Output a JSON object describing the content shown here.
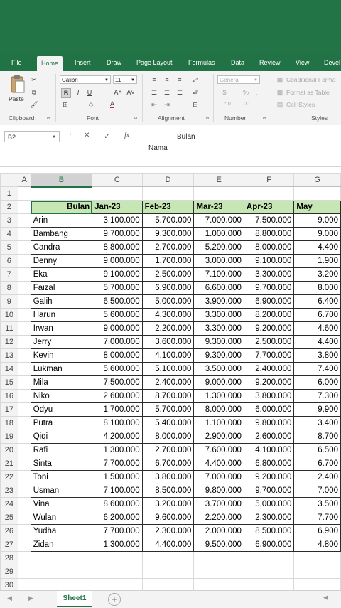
{
  "ribbon": {
    "tabs": [
      "File",
      "Home",
      "Insert",
      "Draw",
      "Page Layout",
      "Formulas",
      "Data",
      "Review",
      "View",
      "Devel"
    ],
    "active_tab": "Home",
    "clipboard": {
      "paste_label": "Paste",
      "group_label": "Clipboard"
    },
    "font": {
      "font_name": "Calibri",
      "font_size": "11",
      "bold": "B",
      "italic": "I",
      "underline": "U",
      "grow": "A˄",
      "shrink": "A˅",
      "color_a": "A",
      "group_label": "Font"
    },
    "alignment": {
      "group_label": "Alignment"
    },
    "number": {
      "format": "General",
      "currency": "$",
      "percent": "%",
      "comma": ",",
      "group_label": "Number"
    },
    "styles": {
      "conditional": "Conditional Forma",
      "format_table": "Format as Table",
      "cell_styles": "Cell Styles",
      "group_label": "Styles"
    }
  },
  "formula_bar": {
    "name_box": "B2",
    "cancel": "✕",
    "enter": "✓",
    "fx": "fx",
    "content_line1": "Bulan",
    "content_line2": "Nama"
  },
  "grid": {
    "columns": [
      "A",
      "B",
      "C",
      "D",
      "E",
      "F",
      "G"
    ],
    "selected_column": "B",
    "header_row": [
      "Bulan",
      "Jan-23",
      "Feb-23",
      "Mar-23",
      "Apr-23",
      "May"
    ],
    "rows": [
      {
        "name": "Arin",
        "values": [
          "3.100.000",
          "5.700.000",
          "7.000.000",
          "7.500.000",
          "9.000"
        ]
      },
      {
        "name": "Bambang",
        "values": [
          "9.700.000",
          "9.300.000",
          "1.000.000",
          "8.800.000",
          "9.000"
        ]
      },
      {
        "name": "Candra",
        "values": [
          "8.800.000",
          "2.700.000",
          "5.200.000",
          "8.000.000",
          "4.400"
        ]
      },
      {
        "name": "Denny",
        "values": [
          "9.000.000",
          "1.700.000",
          "3.000.000",
          "9.100.000",
          "1.900"
        ]
      },
      {
        "name": "Eka",
        "values": [
          "9.100.000",
          "2.500.000",
          "7.100.000",
          "3.300.000",
          "3.200"
        ]
      },
      {
        "name": "Faizal",
        "values": [
          "5.700.000",
          "6.900.000",
          "6.600.000",
          "9.700.000",
          "8.000"
        ]
      },
      {
        "name": "Galih",
        "values": [
          "6.500.000",
          "5.000.000",
          "3.900.000",
          "6.900.000",
          "6.400"
        ]
      },
      {
        "name": "Harun",
        "values": [
          "5.600.000",
          "4.300.000",
          "3.300.000",
          "8.200.000",
          "6.700"
        ]
      },
      {
        "name": "Irwan",
        "values": [
          "9.000.000",
          "2.200.000",
          "3.300.000",
          "9.200.000",
          "4.600"
        ]
      },
      {
        "name": "Jerry",
        "values": [
          "7.000.000",
          "3.600.000",
          "9.300.000",
          "2.500.000",
          "4.400"
        ]
      },
      {
        "name": "Kevin",
        "values": [
          "8.000.000",
          "4.100.000",
          "9.300.000",
          "7.700.000",
          "3.800"
        ]
      },
      {
        "name": "Lukman",
        "values": [
          "5.600.000",
          "5.100.000",
          "3.500.000",
          "2.400.000",
          "7.400"
        ]
      },
      {
        "name": "Mila",
        "values": [
          "7.500.000",
          "2.400.000",
          "9.000.000",
          "9.200.000",
          "6.000"
        ]
      },
      {
        "name": "Niko",
        "values": [
          "2.600.000",
          "8.700.000",
          "1.300.000",
          "3.800.000",
          "7.300"
        ]
      },
      {
        "name": "Odyu",
        "values": [
          "1.700.000",
          "5.700.000",
          "8.000.000",
          "6.000.000",
          "9.900"
        ]
      },
      {
        "name": "Putra",
        "values": [
          "8.100.000",
          "5.400.000",
          "1.100.000",
          "9.800.000",
          "3.400"
        ]
      },
      {
        "name": "Qiqi",
        "values": [
          "4.200.000",
          "8.000.000",
          "2.900.000",
          "2.600.000",
          "8.700"
        ]
      },
      {
        "name": "Rafi",
        "values": [
          "1.300.000",
          "2.700.000",
          "7.600.000",
          "4.100.000",
          "6.500"
        ]
      },
      {
        "name": "Sinta",
        "values": [
          "7.700.000",
          "6.700.000",
          "4.400.000",
          "6.800.000",
          "6.700"
        ]
      },
      {
        "name": "Toni",
        "values": [
          "1.500.000",
          "3.800.000",
          "7.000.000",
          "9.200.000",
          "2.400"
        ]
      },
      {
        "name": "Usman",
        "values": [
          "7.100.000",
          "8.500.000",
          "9.800.000",
          "9.700.000",
          "7.000"
        ]
      },
      {
        "name": "Vina",
        "values": [
          "8.600.000",
          "3.200.000",
          "3.700.000",
          "5.000.000",
          "3.500"
        ]
      },
      {
        "name": "Wulan",
        "values": [
          "6.200.000",
          "9.600.000",
          "2.200.000",
          "2.300.000",
          "7.700"
        ]
      },
      {
        "name": "Yudha",
        "values": [
          "7.700.000",
          "2.300.000",
          "2.000.000",
          "8.500.000",
          "6.900"
        ]
      },
      {
        "name": "Zidan",
        "values": [
          "1.300.000",
          "4.400.000",
          "9.500.000",
          "6.900.000",
          "4.800"
        ]
      }
    ],
    "row_numbers": [
      "1",
      "2",
      "3",
      "4",
      "5",
      "6",
      "7",
      "8",
      "9",
      "10",
      "11",
      "12",
      "13",
      "14",
      "15",
      "16",
      "17",
      "18",
      "19",
      "20",
      "21",
      "22",
      "23",
      "24",
      "25",
      "26",
      "27",
      "28",
      "29",
      "30"
    ]
  },
  "sheet_tabs": {
    "active": "Sheet1",
    "add": "+"
  },
  "colors": {
    "excel_green": "#217346",
    "header_fill": "#c6e6b4"
  }
}
